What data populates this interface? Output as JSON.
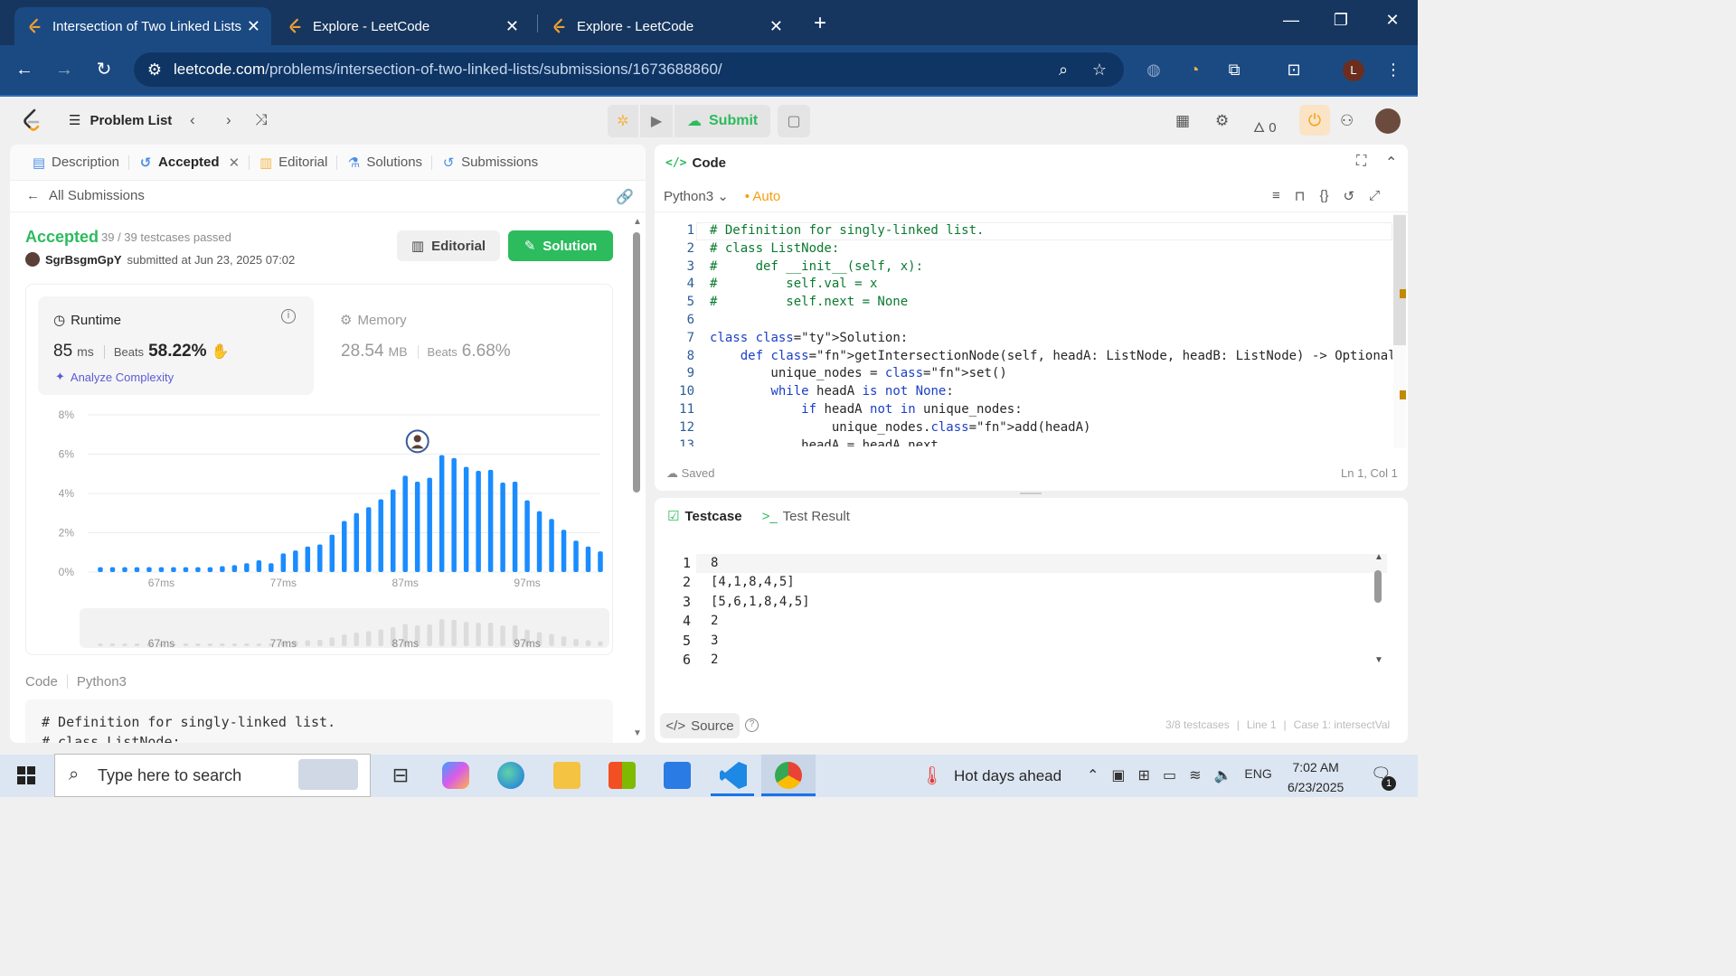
{
  "browser": {
    "tabs": [
      {
        "title": "Intersection of Two Linked Lists",
        "active": true
      },
      {
        "title": "Explore - LeetCode",
        "active": false
      },
      {
        "title": "Explore - LeetCode",
        "active": false
      }
    ],
    "url_host": "leetcode.com",
    "url_path": "/problems/intersection-of-two-linked-lists/submissions/1673688860/",
    "profile_initial": "L"
  },
  "nav": {
    "problem_list": "Problem List",
    "submit": "Submit",
    "streak": "0"
  },
  "left": {
    "tabs": [
      "Description",
      "Accepted",
      "Editorial",
      "Solutions",
      "Submissions"
    ],
    "all_submissions": "All Submissions",
    "status": "Accepted",
    "testcases": "39 / 39 testcases passed",
    "user": "SgrBsgmGpY",
    "submitted": "submitted at Jun 23, 2025 07:02",
    "editorial_btn": "Editorial",
    "solution_btn": "Solution",
    "runtime": {
      "label": "Runtime",
      "value": "85",
      "unit": "ms",
      "beats_label": "Beats",
      "beats": "58.22%"
    },
    "analyze": "Analyze Complexity",
    "memory": {
      "label": "Memory",
      "value": "28.54",
      "unit": "MB",
      "beats_label": "Beats",
      "beats": "6.68%"
    },
    "code_label": "Code",
    "code_lang": "Python3",
    "code_preview": [
      "# Definition for singly-linked list.",
      "# class ListNode:"
    ]
  },
  "chart_data": {
    "type": "bar",
    "ylabel_ticks": [
      "8%",
      "6%",
      "4%",
      "2%",
      "0%"
    ],
    "ylim": [
      0,
      8
    ],
    "x_tick_labels": [
      "67ms",
      "77ms",
      "87ms",
      "97ms"
    ],
    "x": [
      62,
      63,
      64,
      65,
      66,
      67,
      68,
      69,
      70,
      71,
      72,
      73,
      74,
      75,
      76,
      77,
      78,
      79,
      80,
      81,
      82,
      83,
      84,
      85,
      86,
      87,
      88,
      89,
      90,
      91,
      92,
      93,
      94,
      95,
      96,
      97,
      98,
      99
    ],
    "values": [
      0.25,
      0.25,
      0.25,
      0.25,
      0.25,
      0.25,
      0.25,
      0.25,
      0.25,
      0.25,
      0.3,
      0.35,
      0.45,
      0.6,
      0.45,
      0.95,
      1.1,
      1.3,
      1.4,
      1.9,
      2.6,
      3.0,
      3.3,
      3.7,
      4.2,
      4.9,
      4.6,
      4.8,
      5.95,
      5.8,
      5.35,
      5.15,
      5.2,
      4.55,
      4.6,
      3.65,
      3.1,
      2.7,
      2.15,
      1.6,
      1.3,
      1.05
    ],
    "highlight_x": 87,
    "color": "#1a8cff"
  },
  "code": {
    "title": "Code",
    "lang": "Python3",
    "mode": "Auto",
    "lines": [
      "# Definition for singly-linked list.",
      "# class ListNode:",
      "#     def __init__(self, x):",
      "#         self.val = x",
      "#         self.next = None",
      "",
      "class Solution:",
      "    def getIntersectionNode(self, headA: ListNode, headB: ListNode) -> Optional[ListNode]:",
      "        unique_nodes = set()",
      "        while headA is not None:",
      "            if headA not in unique_nodes:",
      "                unique_nodes.add(headA)",
      "            headA = headA.next"
    ],
    "saved": "Saved",
    "cursor": "Ln 1, Col 1"
  },
  "testcase": {
    "tab_testcase": "Testcase",
    "tab_result": "Test Result",
    "lines": [
      "8",
      "[4,1,8,4,5]",
      "[5,6,1,8,4,5]",
      "2",
      "3",
      "2"
    ],
    "source": "Source",
    "footer": [
      "3/8 testcases",
      "Line 1",
      "Case 1: intersectVal"
    ]
  },
  "taskbar": {
    "search": "Type here to search",
    "weather": "Hot days ahead",
    "lang": "ENG",
    "time": "7:02 AM",
    "date": "6/23/2025",
    "notif_count": "1"
  }
}
